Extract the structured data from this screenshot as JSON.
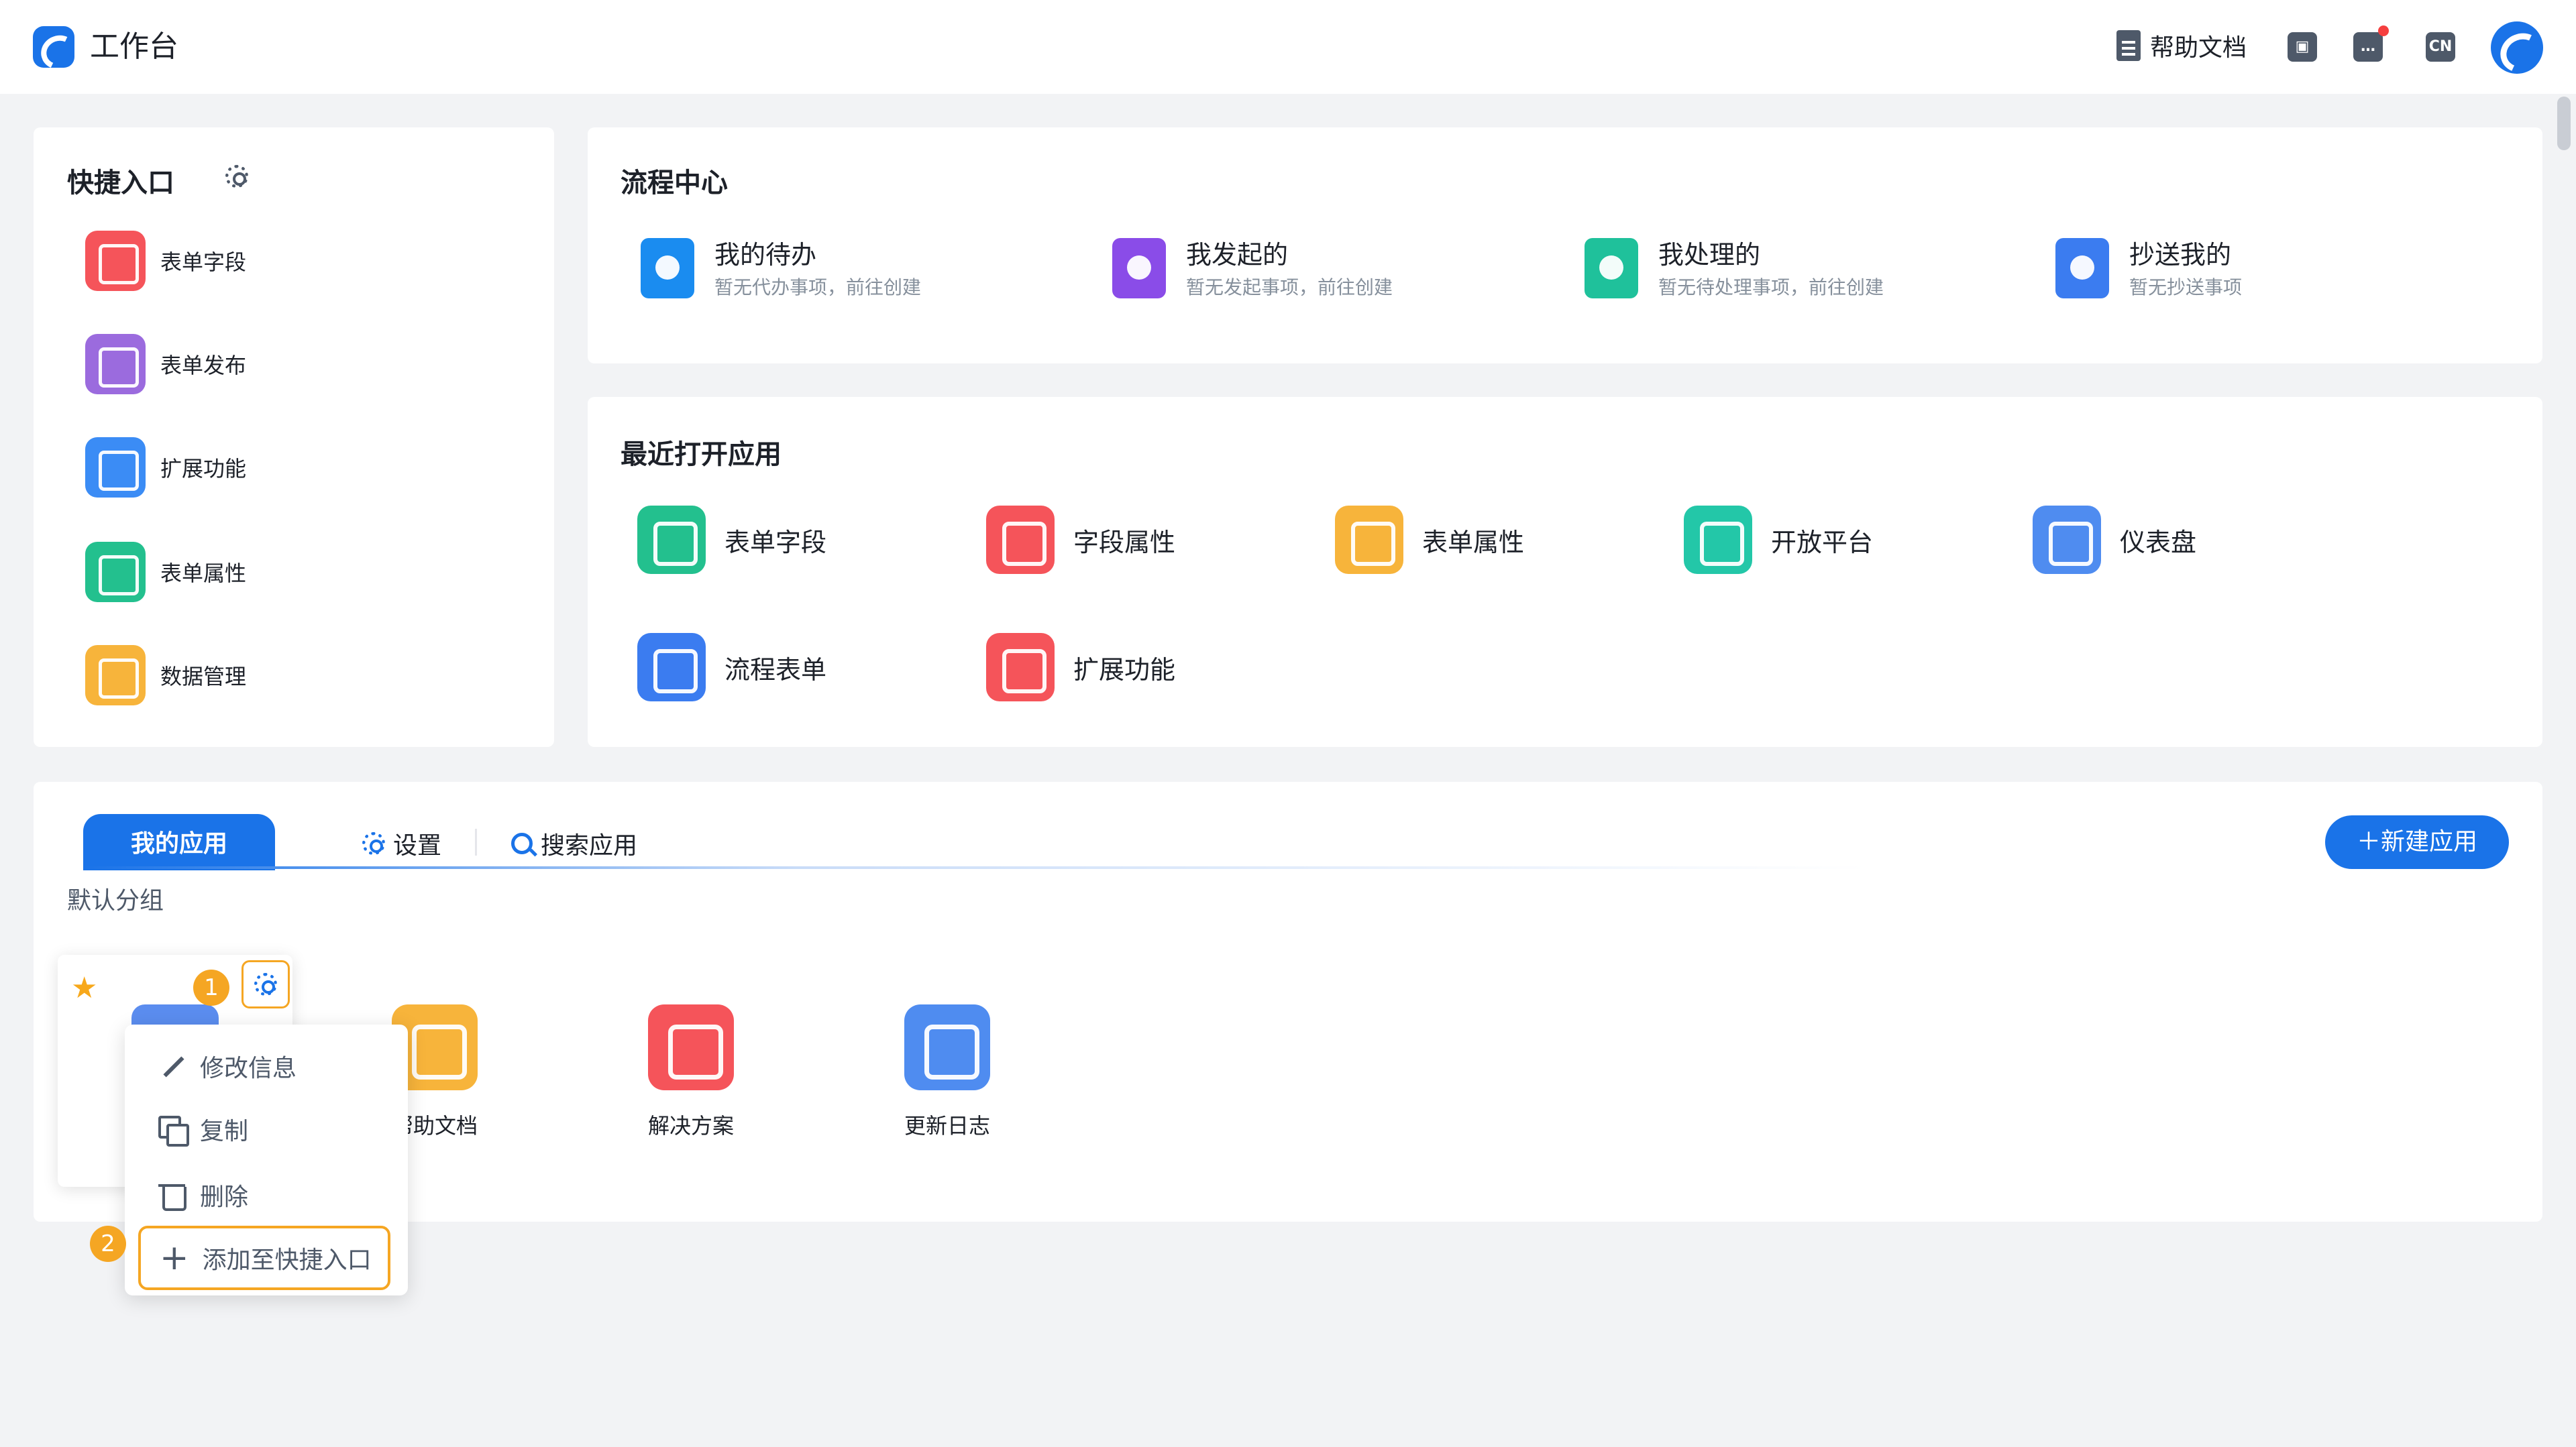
{
  "header": {
    "app_title": "工作台",
    "help_doc": "帮助文档",
    "lang_badge": "CN",
    "icons": [
      "logo-icon",
      "doc-icon",
      "contact-icon",
      "message-icon",
      "language-icon",
      "avatar"
    ]
  },
  "quick_entry": {
    "title": "快捷入口",
    "items": [
      {
        "label": "表单字段",
        "color": "#f5545a"
      },
      {
        "label": "表单发布",
        "color": "#9b6bde"
      },
      {
        "label": "扩展功能",
        "color": "#3b8cf5"
      },
      {
        "label": "表单属性",
        "color": "#23c08e"
      },
      {
        "label": "数据管理",
        "color": "#f7b43b"
      }
    ]
  },
  "process_center": {
    "title": "流程中心",
    "items": [
      {
        "label": "我的待办",
        "sub": "暂无代办事项，前往创建",
        "color": "#1a8cf0"
      },
      {
        "label": "我发起的",
        "sub": "暂无发起事项，前往创建",
        "color": "#8a4ce8"
      },
      {
        "label": "我处理的",
        "sub": "暂无待处理事项，前往创建",
        "color": "#1fc19b"
      },
      {
        "label": "抄送我的",
        "sub": "暂无抄送事项",
        "color": "#3b7cf0"
      }
    ]
  },
  "recent_apps": {
    "title": "最近打开应用",
    "items": [
      {
        "label": "表单字段",
        "color": "#23c08e"
      },
      {
        "label": "字段属性",
        "color": "#f5545a"
      },
      {
        "label": "表单属性",
        "color": "#f7b43b"
      },
      {
        "label": "开放平台",
        "color": "#23c7a8"
      },
      {
        "label": "仪表盘",
        "color": "#4f8cf0"
      },
      {
        "label": "流程表单",
        "color": "#3b7cf0"
      },
      {
        "label": "扩展功能",
        "color": "#f5545a"
      }
    ]
  },
  "my_apps": {
    "tab_active": "我的应用",
    "settings": "设置",
    "search": "搜索应用",
    "new_app": "新建应用",
    "group": "默认分组",
    "badge_1": "1",
    "badge_2": "2",
    "apps": [
      {
        "label": "帮助文档",
        "color": "#f7b43b"
      },
      {
        "label": "解决方案",
        "color": "#f5545a"
      },
      {
        "label": "更新日志",
        "color": "#4f8cf0"
      }
    ]
  },
  "context_menu": {
    "edit": "修改信息",
    "copy": "复制",
    "delete": "删除",
    "add_quick": "添加至快捷入口"
  },
  "accent_color": "#1a73e8"
}
